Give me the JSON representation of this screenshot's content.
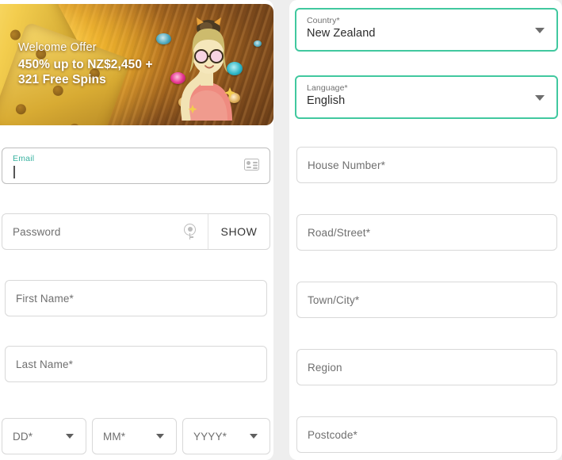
{
  "promo": {
    "title": "Welcome Offer",
    "line1": "450% up to NZ$2,450 +",
    "line2": "321 Free Spins",
    "icon_dice": "dice-icon",
    "icon_character": "character-illustration",
    "icon_chips": "casino-chip-icon"
  },
  "left_form": {
    "email": {
      "label": "Email",
      "value": "",
      "placeholder": "Email",
      "focused": true,
      "autofill_icon": "contact-card-icon"
    },
    "password": {
      "placeholder": "Password",
      "value": "",
      "show_label": "SHOW",
      "autofill_icon": "key-icon"
    },
    "first_name": {
      "placeholder": "First Name*",
      "value": ""
    },
    "last_name": {
      "placeholder": "Last Name*",
      "value": ""
    },
    "dob": {
      "day": {
        "placeholder": "DD*",
        "value": ""
      },
      "month": {
        "placeholder": "MM*",
        "value": ""
      },
      "year": {
        "placeholder": "YYYY*",
        "value": ""
      }
    }
  },
  "right_form": {
    "country": {
      "label": "Country*",
      "value": "New Zealand"
    },
    "language": {
      "label": "Language*",
      "value": "English"
    },
    "house_number": {
      "placeholder": "House Number*",
      "value": ""
    },
    "road_street": {
      "placeholder": "Road/Street*",
      "value": ""
    },
    "town_city": {
      "placeholder": "Town/City*",
      "value": ""
    },
    "region": {
      "placeholder": "Region",
      "value": ""
    },
    "postcode": {
      "placeholder": "Postcode*",
      "value": ""
    }
  },
  "colors": {
    "accent_teal": "#41c89f",
    "focus_label": "#38b2a0",
    "page_background": "#eeeeee",
    "field_border": "#d8d8d8",
    "promo_gold": "#f3cd4e",
    "promo_brown": "#5c3414"
  }
}
